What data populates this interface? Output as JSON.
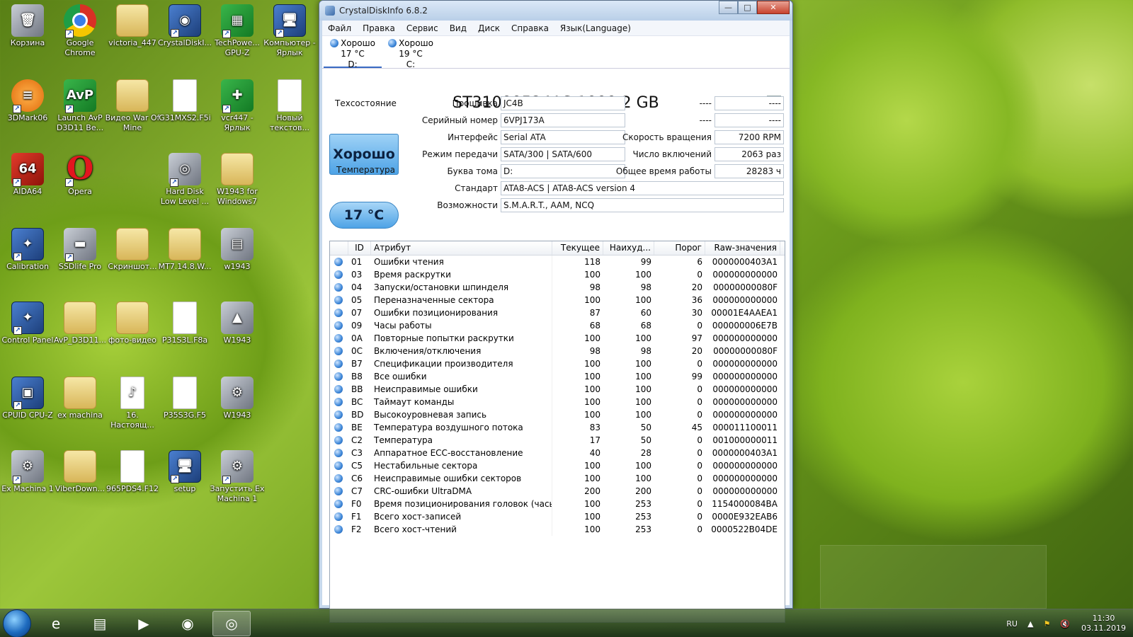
{
  "desktop": {
    "icons": [
      {
        "label": "Корзина",
        "glyph": "🗑",
        "kind": "gray",
        "col": 0,
        "row": 0,
        "shortcut": false
      },
      {
        "label": "Google Chrome",
        "glyph": "",
        "kind": "chrome",
        "col": 1,
        "row": 0,
        "shortcut": true
      },
      {
        "label": "victoria_447",
        "glyph": "",
        "kind": "folder",
        "col": 2,
        "row": 0,
        "shortcut": false
      },
      {
        "label": "CrystalDiskI...",
        "glyph": "◉",
        "kind": "app",
        "col": 3,
        "row": 0,
        "shortcut": true
      },
      {
        "label": "TechPowe... GPU-Z",
        "glyph": "▦",
        "kind": "green",
        "col": 4,
        "row": 0,
        "shortcut": true
      },
      {
        "label": "Компьютер - Ярлык",
        "glyph": "🖥",
        "kind": "app",
        "col": 5,
        "row": 0,
        "shortcut": true
      },
      {
        "label": "3DMark06",
        "glyph": "≡",
        "kind": "orange",
        "col": 0,
        "row": 1,
        "shortcut": true
      },
      {
        "label": "Launch AvP D3D11 Be...",
        "glyph": "AvP",
        "kind": "green",
        "col": 1,
        "row": 1,
        "shortcut": true
      },
      {
        "label": "Видео War Of Mine",
        "glyph": "",
        "kind": "folder",
        "col": 2,
        "row": 1,
        "shortcut": false
      },
      {
        "label": "G31MXS2.F5i",
        "glyph": "",
        "kind": "file",
        "col": 3,
        "row": 1,
        "shortcut": false
      },
      {
        "label": "vcr447 - Ярлык",
        "glyph": "✚",
        "kind": "green",
        "col": 4,
        "row": 1,
        "shortcut": true
      },
      {
        "label": "Новый текстов...",
        "glyph": "",
        "kind": "file",
        "col": 5,
        "row": 1,
        "shortcut": false
      },
      {
        "label": "AIDA64",
        "glyph": "64",
        "kind": "red",
        "col": 0,
        "row": 2,
        "shortcut": true
      },
      {
        "label": "Opera",
        "glyph": "O",
        "kind": "opera",
        "col": 1,
        "row": 2,
        "shortcut": true
      },
      {
        "label": "Hard Disk Low Level ...",
        "glyph": "◎",
        "kind": "gray",
        "col": 3,
        "row": 2,
        "shortcut": true
      },
      {
        "label": "W1943 for Windows7",
        "glyph": "",
        "kind": "folder",
        "col": 4,
        "row": 2,
        "shortcut": false
      },
      {
        "label": "Calibration",
        "glyph": "✦",
        "kind": "app",
        "col": 0,
        "row": 3,
        "shortcut": true
      },
      {
        "label": "SSDlife Pro",
        "glyph": "▬",
        "kind": "gray",
        "col": 1,
        "row": 3,
        "shortcut": true
      },
      {
        "label": "Скриншот...",
        "glyph": "",
        "kind": "folder",
        "col": 2,
        "row": 3,
        "shortcut": false
      },
      {
        "label": "MT7.14.8.W...",
        "glyph": "",
        "kind": "folder",
        "col": 3,
        "row": 3,
        "shortcut": false
      },
      {
        "label": "w1943",
        "glyph": "▤",
        "kind": "gray",
        "col": 4,
        "row": 3,
        "shortcut": false
      },
      {
        "label": "Control Panel",
        "glyph": "✦",
        "kind": "app",
        "col": 0,
        "row": 4,
        "shortcut": true
      },
      {
        "label": "AvP_D3D11...",
        "glyph": "",
        "kind": "folder",
        "col": 1,
        "row": 4,
        "shortcut": false
      },
      {
        "label": "фото-видео",
        "glyph": "",
        "kind": "folder",
        "col": 2,
        "row": 4,
        "shortcut": false
      },
      {
        "label": "P31S3L.F8a",
        "glyph": "",
        "kind": "file",
        "col": 3,
        "row": 4,
        "shortcut": false
      },
      {
        "label": "W1943",
        "glyph": "▲",
        "kind": "gray",
        "col": 4,
        "row": 4,
        "shortcut": false
      },
      {
        "label": "CPUID CPU-Z",
        "glyph": "▣",
        "kind": "app",
        "col": 0,
        "row": 5,
        "shortcut": true
      },
      {
        "label": "ex machina",
        "glyph": "",
        "kind": "folder",
        "col": 1,
        "row": 5,
        "shortcut": false
      },
      {
        "label": "16. Настоящ...",
        "glyph": "♪",
        "kind": "file",
        "col": 2,
        "row": 5,
        "shortcut": false
      },
      {
        "label": "P35S3G.F5",
        "glyph": "",
        "kind": "file",
        "col": 3,
        "row": 5,
        "shortcut": false
      },
      {
        "label": "W1943",
        "glyph": "⚙",
        "kind": "gray",
        "col": 4,
        "row": 5,
        "shortcut": false
      },
      {
        "label": "Ex Machina 1",
        "glyph": "⚙",
        "kind": "gray",
        "col": 0,
        "row": 6,
        "shortcut": true
      },
      {
        "label": "ViberDown...",
        "glyph": "",
        "kind": "folder",
        "col": 1,
        "row": 6,
        "shortcut": false
      },
      {
        "label": "965PDS4.F12",
        "glyph": "",
        "kind": "file",
        "col": 2,
        "row": 6,
        "shortcut": false
      },
      {
        "label": "setup",
        "glyph": "🖥",
        "kind": "app",
        "col": 3,
        "row": 6,
        "shortcut": true
      },
      {
        "label": "Запустить Ex Machina 1",
        "glyph": "⚙",
        "kind": "gray",
        "col": 4,
        "row": 6,
        "shortcut": true
      }
    ]
  },
  "window": {
    "title": "CrystalDiskInfo 6.8.2",
    "controls": {
      "minimize": "—",
      "maximize": "□",
      "close": "✕"
    },
    "menu": [
      "Файл",
      "Правка",
      "Сервис",
      "Вид",
      "Диск",
      "Справка",
      "Язык(Language)"
    ],
    "drives": [
      {
        "status": "Хорошо",
        "temp": "17 °C",
        "letter": "D:",
        "active": true
      },
      {
        "status": "Хорошо",
        "temp": "19 °C",
        "letter": "C:",
        "active": false
      }
    ],
    "model": "ST31000524AS 1000,2 GB",
    "health_label": "Техсостояние",
    "health_value": "Хорошо",
    "temp_label": "Температура",
    "temp_value": "17 °C",
    "fields": {
      "firmware": {
        "label": "Прошивка",
        "value": "JC4B"
      },
      "serial": {
        "label": "Серийный номер",
        "value": "6VPJ173A"
      },
      "interface": {
        "label": "Интерфейс",
        "value": "Serial ATA"
      },
      "transfer": {
        "label": "Режим передачи",
        "value": "SATA/300 | SATA/600"
      },
      "letter": {
        "label": "Буква тома",
        "value": "D:"
      },
      "standard": {
        "label": "Стандарт",
        "value": "ATA8-ACS | ATA8-ACS version 4"
      },
      "features": {
        "label": "Возможности",
        "value": "S.M.A.R.T., AAM, NCQ"
      },
      "extra1": {
        "label": "----",
        "value": "----"
      },
      "extra2": {
        "label": "----",
        "value": "----"
      },
      "rotation": {
        "label": "Скорость вращения",
        "value": "7200 RPM"
      },
      "power_count": {
        "label": "Число включений",
        "value": "2063 раз"
      },
      "power_hours": {
        "label": "Общее время работы",
        "value": "28283 ч"
      }
    },
    "table": {
      "headers": [
        "ID",
        "Атрибут",
        "Текущее",
        "Наихуд...",
        "Порог",
        "Raw-значения"
      ],
      "rows": [
        [
          "01",
          "Ошибки чтения",
          "118",
          "99",
          "6",
          "0000000403A1"
        ],
        [
          "03",
          "Время раскрутки",
          "100",
          "100",
          "0",
          "000000000000"
        ],
        [
          "04",
          "Запуски/остановки шпинделя",
          "98",
          "98",
          "20",
          "00000000080F"
        ],
        [
          "05",
          "Переназначенные сектора",
          "100",
          "100",
          "36",
          "000000000000"
        ],
        [
          "07",
          "Ошибки позиционирования",
          "87",
          "60",
          "30",
          "00001E4AAEA1"
        ],
        [
          "09",
          "Часы работы",
          "68",
          "68",
          "0",
          "000000006E7B"
        ],
        [
          "0A",
          "Повторные попытки раскрутки",
          "100",
          "100",
          "97",
          "000000000000"
        ],
        [
          "0C",
          "Включения/отключения",
          "98",
          "98",
          "20",
          "00000000080F"
        ],
        [
          "B7",
          "Спецификации производителя",
          "100",
          "100",
          "0",
          "000000000000"
        ],
        [
          "B8",
          "Все ошибки",
          "100",
          "100",
          "99",
          "000000000000"
        ],
        [
          "BB",
          "Неисправимые ошибки",
          "100",
          "100",
          "0",
          "000000000000"
        ],
        [
          "BC",
          "Таймаут команды",
          "100",
          "100",
          "0",
          "000000000000"
        ],
        [
          "BD",
          "Высокоуровневая запись",
          "100",
          "100",
          "0",
          "000000000000"
        ],
        [
          "BE",
          "Температура воздушного потока",
          "83",
          "50",
          "45",
          "000011100011"
        ],
        [
          "C2",
          "Температура",
          "17",
          "50",
          "0",
          "001000000011"
        ],
        [
          "C3",
          "Аппаратное ECC-восстановление",
          "40",
          "28",
          "0",
          "0000000403A1"
        ],
        [
          "C5",
          "Нестабильные сектора",
          "100",
          "100",
          "0",
          "000000000000"
        ],
        [
          "C6",
          "Неисправимые ошибки секторов",
          "100",
          "100",
          "0",
          "000000000000"
        ],
        [
          "C7",
          "CRC-ошибки UltraDMA",
          "200",
          "200",
          "0",
          "000000000000"
        ],
        [
          "F0",
          "Время позиционирования головок (часы)",
          "100",
          "253",
          "0",
          "1154000084BA"
        ],
        [
          "F1",
          "Всего хост-записей",
          "100",
          "253",
          "0",
          "0000E932EAB6"
        ],
        [
          "F2",
          "Всего хост-чтений",
          "100",
          "253",
          "0",
          "0000522B04DE"
        ]
      ]
    }
  },
  "taskbar": {
    "apps": [
      {
        "name": "ie",
        "glyph": "e",
        "active": false
      },
      {
        "name": "explorer",
        "glyph": "▤",
        "active": false
      },
      {
        "name": "media",
        "glyph": "▶",
        "active": false
      },
      {
        "name": "chrome",
        "glyph": "◉",
        "active": false
      },
      {
        "name": "crystaldisk",
        "glyph": "◎",
        "active": true
      }
    ],
    "lang": "RU",
    "tray_arrow": "▲",
    "time": "11:30",
    "date": "03.11.2019"
  },
  "colors": {
    "accent": "#3a6bc4",
    "health": "#4ea3e6"
  }
}
